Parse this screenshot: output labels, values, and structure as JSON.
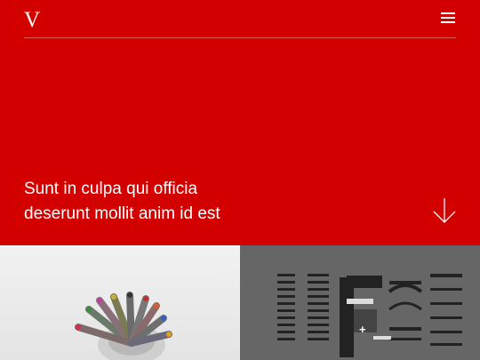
{
  "header": {
    "logo_text": "V",
    "menu_icon": "hamburger-menu-icon"
  },
  "hero": {
    "background_color": "#d30000",
    "headline_line1": "Sunt in culpa qui officia",
    "headline_line2": "deserunt mollit anim id est",
    "scroll_icon": "arrow-down-icon"
  },
  "gallery": {
    "items": [
      {
        "image": "colored-pencils-in-glass-photo"
      },
      {
        "image": "typewriter-parts-flatlay-photo",
        "overlay_icon": "plus-icon",
        "overlay_text": "+"
      }
    ]
  }
}
